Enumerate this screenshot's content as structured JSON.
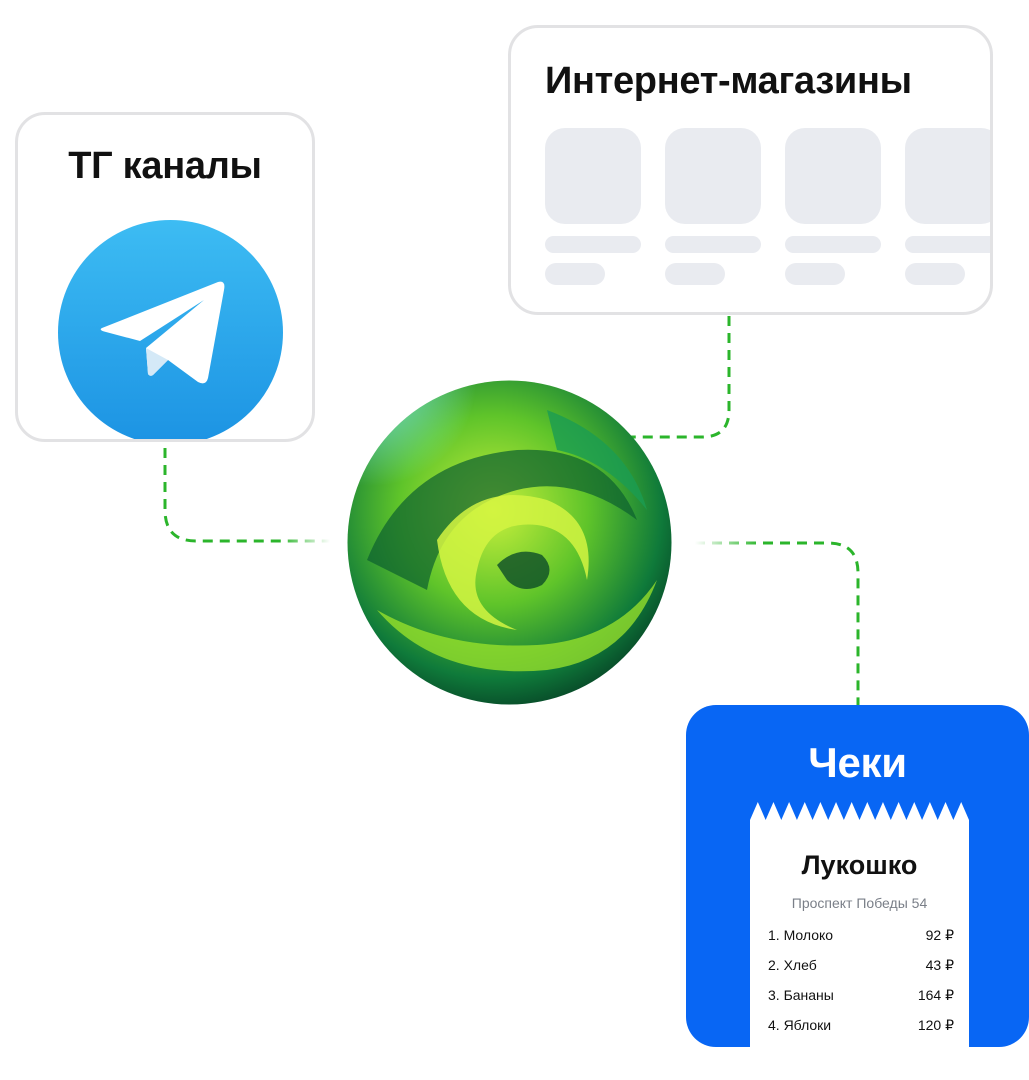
{
  "tg_card": {
    "title": "ТГ каналы",
    "icon": "telegram-icon"
  },
  "shops_card": {
    "title": "Интернет-магазины"
  },
  "receipts_card": {
    "title": "Чеки",
    "store_name": "Лукошко",
    "address": "Проспект Победы 54",
    "items": [
      {
        "name": "1. Молоко",
        "price": "92 ₽"
      },
      {
        "name": "2. Хлеб",
        "price": "43 ₽"
      },
      {
        "name": "3. Бананы",
        "price": "164 ₽"
      },
      {
        "name": "4. Яблоки",
        "price": "120 ₽"
      }
    ]
  },
  "colors": {
    "connector": "#2bb52b",
    "receipt_bg": "#0866f4",
    "telegram": "#2aa3e6",
    "placeholder": "#e9ebf0"
  }
}
